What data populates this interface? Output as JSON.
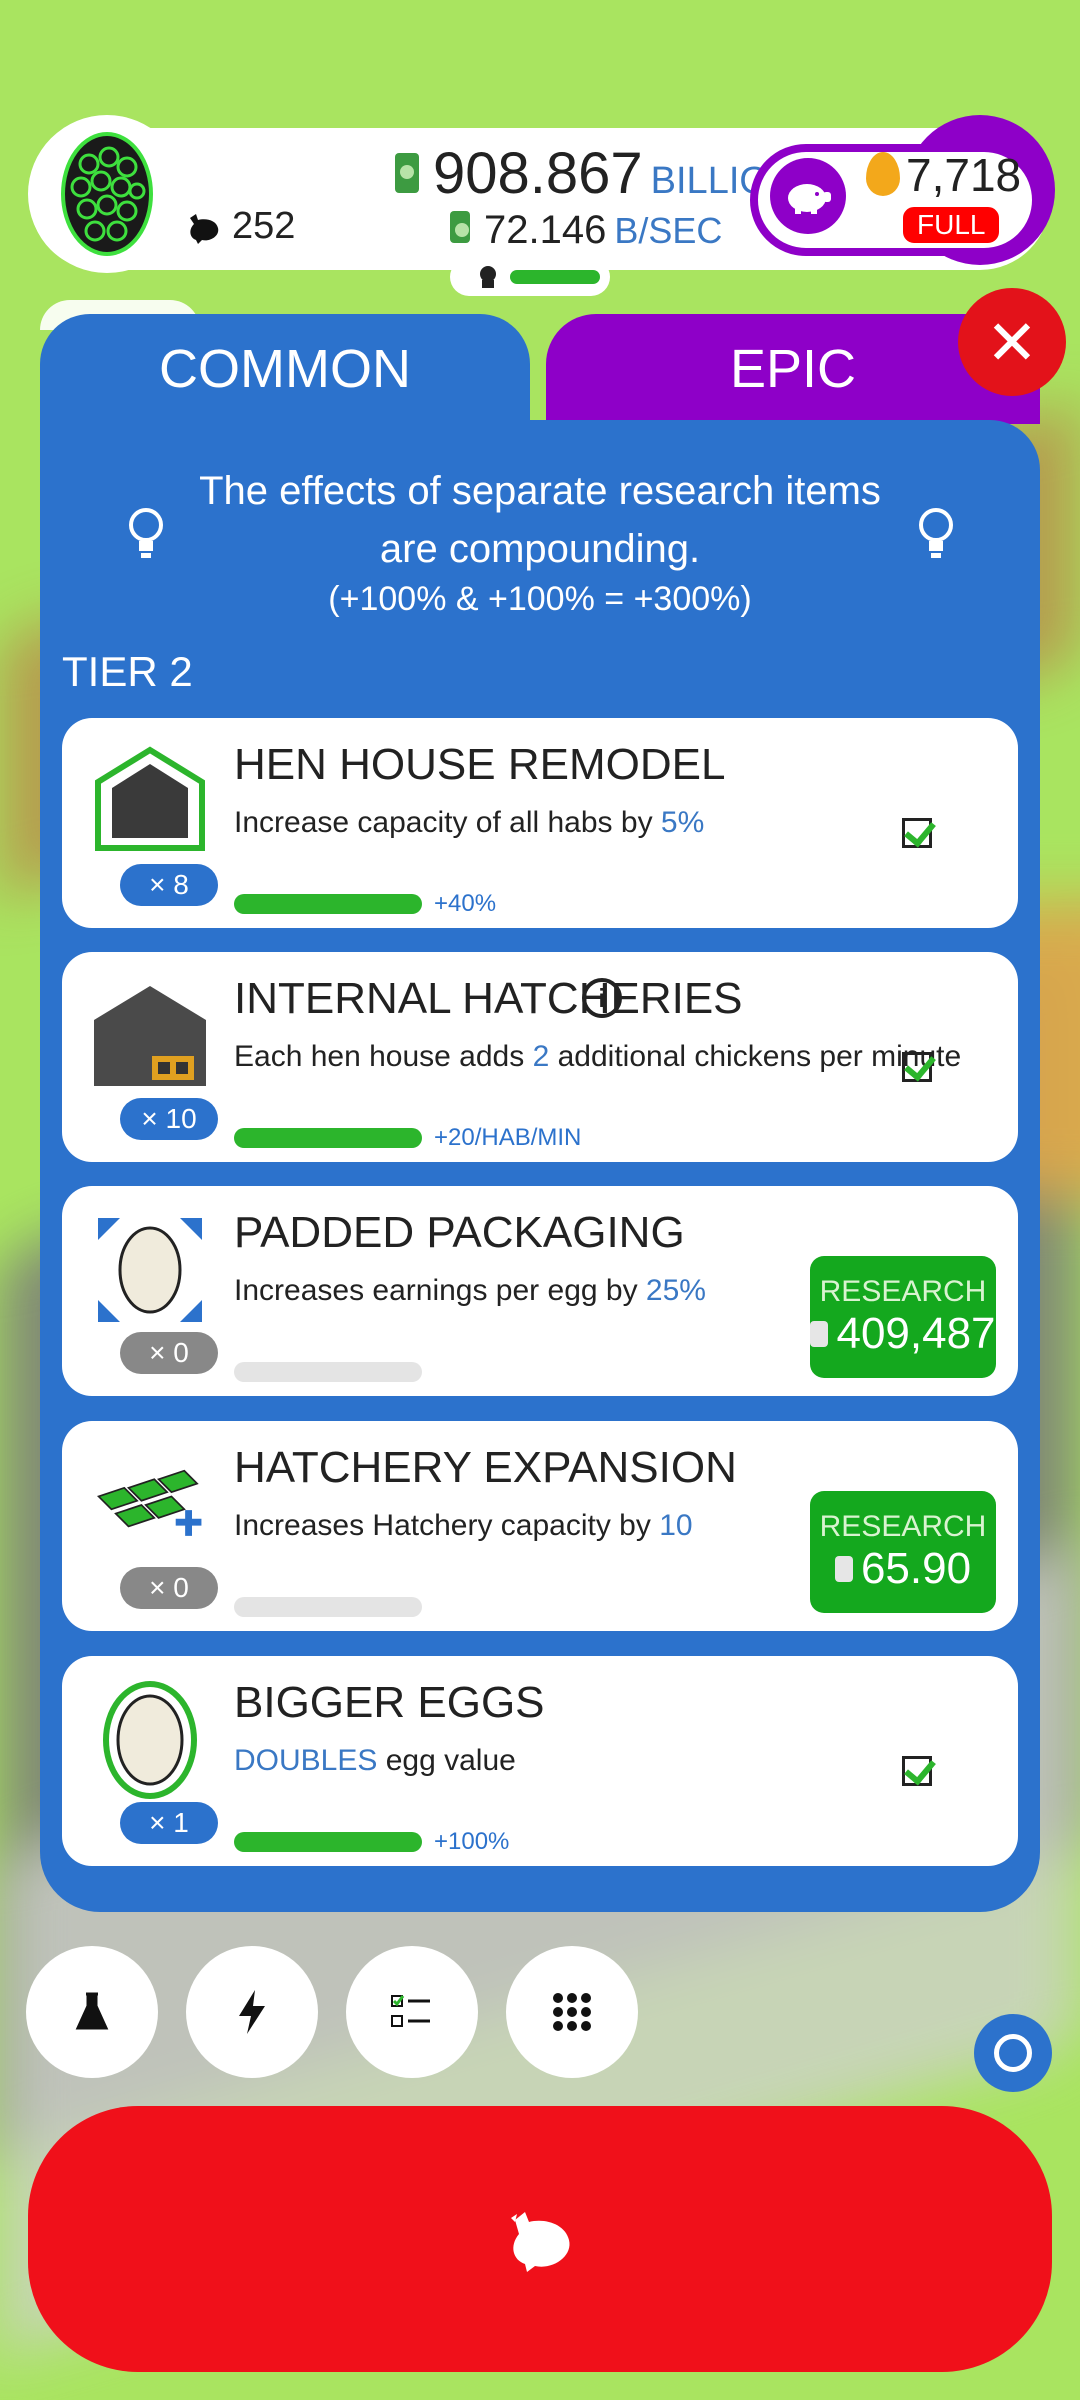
{
  "header": {
    "chicken_count": "252",
    "money_amount": "908.867",
    "money_unit": "BILLION",
    "rate_amount": "72.146",
    "rate_unit": "B/SEC",
    "golden_eggs": "7,718",
    "piggy_status": "FULL"
  },
  "tabs": {
    "common": "COMMON",
    "epic": "EPIC"
  },
  "info": {
    "text": "The effects of separate research items are compounding.",
    "formula": "(+100% & +100% = +300%)"
  },
  "tier_label": "TIER 2",
  "research": [
    {
      "title": "HEN HOUSE REMODEL",
      "desc_pre": "Increase capacity of all habs by ",
      "desc_hl": "5%",
      "desc_post": "",
      "count": "× 8",
      "progress_text": "+40%",
      "status": "done"
    },
    {
      "title": "INTERNAL HATCHERIES",
      "desc_pre": "Each hen house adds ",
      "desc_hl": "2",
      "desc_post": " additional chickens per minute",
      "count": "× 10",
      "progress_text": "+20/HAB/MIN",
      "status": "done"
    },
    {
      "title": "PADDED PACKAGING",
      "desc_pre": "Increases earnings per egg by ",
      "desc_hl": "25%",
      "desc_post": "",
      "count": "× 0",
      "button_label": "RESEARCH",
      "button_cost": "409,487",
      "status": "available"
    },
    {
      "title": "HATCHERY EXPANSION",
      "desc_pre": "Increases Hatchery capacity by ",
      "desc_hl": "10",
      "desc_post": "",
      "count": "× 0",
      "button_label": "RESEARCH",
      "button_cost": "65.90",
      "status": "available"
    },
    {
      "title": "BIGGER EGGS",
      "desc_pre": "",
      "desc_hl": "DOUBLES",
      "desc_post": " egg value",
      "count": "× 1",
      "progress_text": "+100%",
      "status": "done"
    }
  ],
  "bottom_buttons": [
    "flask-icon",
    "lightning-icon",
    "checklist-icon",
    "grid-icon"
  ],
  "colors": {
    "accent_blue": "#2c72cc",
    "epic_purple": "#8e00c8",
    "green": "#14a81e",
    "red": "#f0101a"
  }
}
